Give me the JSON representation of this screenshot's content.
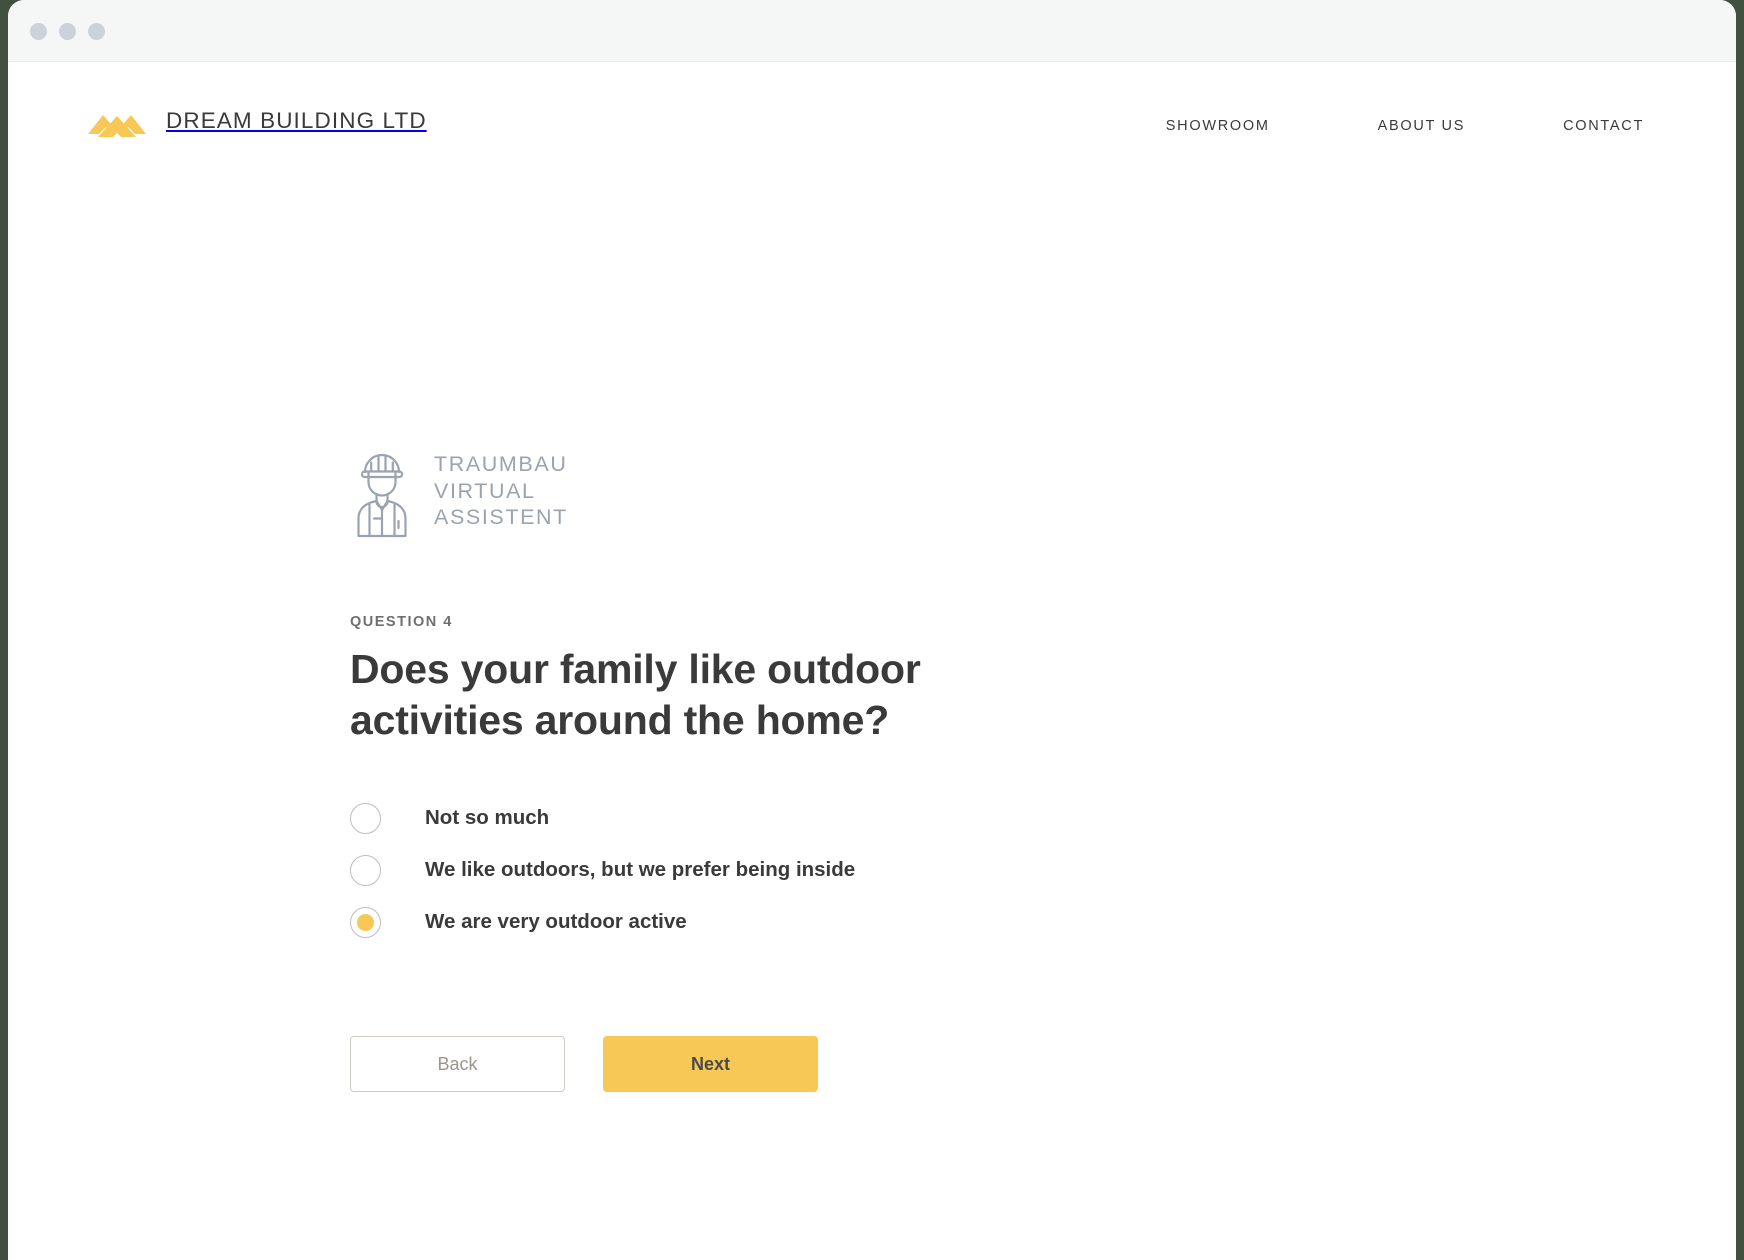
{
  "window": {
    "traffic_lights": [
      "minimize-dot",
      "maximize-dot",
      "close-dot"
    ],
    "chrome_color": "#f5f6f6",
    "page_background": "#42503f"
  },
  "header": {
    "logo_icon": "mountain-peaks-logo",
    "brand_name": "DREAM BUILDING LTD",
    "brand_color": "#f7c855",
    "nav": [
      {
        "label": "SHOWROOM"
      },
      {
        "label": "ABOUT US"
      },
      {
        "label": "CONTACT"
      }
    ]
  },
  "assistant": {
    "icon": "construction-worker-icon",
    "title": "TRAUMBAU\nVIRTUAL\nASSISTENT",
    "title_color": "#9aa3af"
  },
  "question": {
    "kicker": "QUESTION 4",
    "number": 4,
    "text": "Does your family like outdoor activities around the home?",
    "options": [
      {
        "label": "Not so much",
        "selected": false
      },
      {
        "label": "We like outdoors, but we prefer being inside",
        "selected": false
      },
      {
        "label": "We are very outdoor active",
        "selected": true
      }
    ],
    "selected_index": 2,
    "selected_color": "#f7c855"
  },
  "actions": {
    "back_label": "Back",
    "next_label": "Next",
    "next_color": "#f7c855"
  }
}
